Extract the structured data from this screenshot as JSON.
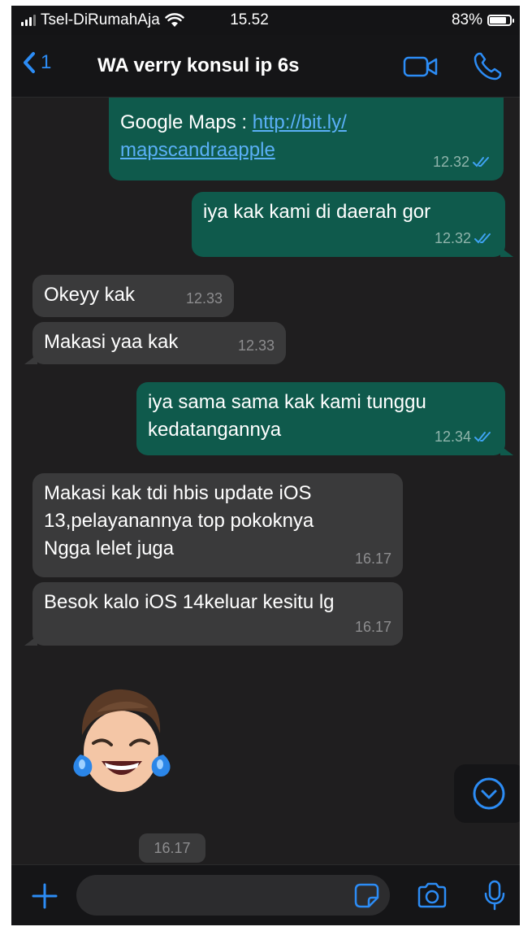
{
  "status_bar": {
    "carrier": "Tsel-DiRumahAja",
    "time": "15.52",
    "battery": "83%"
  },
  "header": {
    "back_count": "1",
    "title": "WA verry konsul ip 6s"
  },
  "messages": [
    {
      "direction": "out",
      "prefix": "Google Maps : ",
      "link_line1": "http://bit.ly/",
      "link_line2": "mapscandraapple",
      "time": "12.32",
      "read": true
    },
    {
      "direction": "out",
      "text": "iya kak kami di daerah gor",
      "time": "12.32",
      "read": true
    },
    {
      "direction": "in",
      "text": "Okeyy kak",
      "time": "12.33"
    },
    {
      "direction": "in",
      "text": "Makasi yaa kak",
      "time": "12.33"
    },
    {
      "direction": "out",
      "line1": "iya sama sama kak kami tunggu",
      "line2": "kedatangannya",
      "time": "12.34",
      "read": true
    },
    {
      "direction": "in",
      "line1": "Makasi kak tdi hbis update iOS",
      "line2": "13,pelayanannya top pokoknya",
      "line3": "Ngga lelet juga",
      "time": "16.17"
    },
    {
      "direction": "in",
      "text": "Besok kalo iOS 14keluar kesitu lg",
      "time": "16.17"
    }
  ],
  "sticker_message": {
    "icon": "crying-laughing-memoji",
    "time": "16.17"
  },
  "composer": {
    "placeholder": ""
  },
  "colors": {
    "accent": "#2c8cf5",
    "outgoing_bubble": "#0f5a4c",
    "incoming_bubble": "#3a3a3b",
    "read_ticks": "#3ea3f2"
  }
}
